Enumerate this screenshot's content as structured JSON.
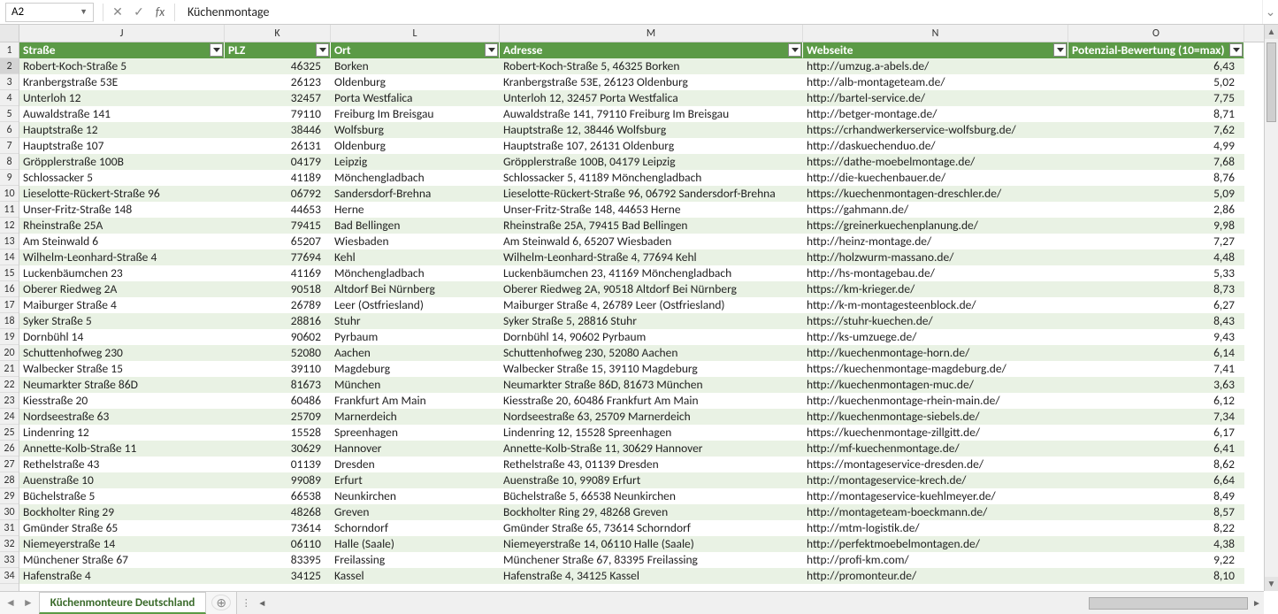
{
  "namebox": "A2",
  "formula": "Küchenmontage",
  "sheet_tab": "Küchenmonteure Deutschland",
  "columns": [
    {
      "letter": "J",
      "header": "Straße",
      "w": "col-j"
    },
    {
      "letter": "K",
      "header": "PLZ",
      "w": "col-k"
    },
    {
      "letter": "L",
      "header": "Ort",
      "w": "col-l"
    },
    {
      "letter": "M",
      "header": "Adresse",
      "w": "col-m"
    },
    {
      "letter": "N",
      "header": "Webseite",
      "w": "col-n"
    },
    {
      "letter": "O",
      "header": "Potenzial-Bewertung (10=max)",
      "w": "col-o"
    }
  ],
  "rows": [
    {
      "n": 2,
      "s": "Robert-Koch-Straße 5",
      "p": "46325",
      "o": "Borken",
      "a": "Robert-Koch-Straße 5, 46325 Borken",
      "w": "http://umzug.a-abels.de/",
      "b": "6,43"
    },
    {
      "n": 3,
      "s": "Kranbergstraße 53E",
      "p": "26123",
      "o": "Oldenburg",
      "a": "Kranbergstraße 53E, 26123 Oldenburg",
      "w": "http://alb-montageteam.de/",
      "b": "5,02"
    },
    {
      "n": 4,
      "s": "Unterloh 12",
      "p": "32457",
      "o": "Porta Westfalica",
      "a": "Unterloh 12, 32457 Porta Westfalica",
      "w": "http://bartel-service.de/",
      "b": "7,75"
    },
    {
      "n": 5,
      "s": "Auwaldstraße 141",
      "p": "79110",
      "o": "Freiburg Im Breisgau",
      "a": "Auwaldstraße 141, 79110 Freiburg Im Breisgau",
      "w": "http://betger-montage.de/",
      "b": "8,71"
    },
    {
      "n": 6,
      "s": "Hauptstraße 12",
      "p": "38446",
      "o": "Wolfsburg",
      "a": "Hauptstraße 12, 38446 Wolfsburg",
      "w": "https://crhandwerkerservice-wolfsburg.de/",
      "b": "7,62"
    },
    {
      "n": 7,
      "s": "Hauptstraße 107",
      "p": "26131",
      "o": "Oldenburg",
      "a": "Hauptstraße 107, 26131 Oldenburg",
      "w": "http://daskuechenduo.de/",
      "b": "4,99"
    },
    {
      "n": 8,
      "s": "Gröpplerstraße 100B",
      "p": "04179",
      "o": "Leipzig",
      "a": "Gröpplerstraße 100B, 04179 Leipzig",
      "w": "https://dathe-moebelmontage.de/",
      "b": "7,68"
    },
    {
      "n": 9,
      "s": "Schlossacker 5",
      "p": "41189",
      "o": "Mönchengladbach",
      "a": "Schlossacker 5, 41189 Mönchengladbach",
      "w": "http://die-kuechenbauer.de/",
      "b": "8,76"
    },
    {
      "n": 10,
      "s": "Lieselotte-Rückert-Straße 96",
      "p": "06792",
      "o": "Sandersdorf-Brehna",
      "a": "Lieselotte-Rückert-Straße 96, 06792 Sandersdorf-Brehna",
      "w": "https://kuechenmontagen-dreschler.de/",
      "b": "5,09"
    },
    {
      "n": 11,
      "s": "Unser-Fritz-Straße 148",
      "p": "44653",
      "o": "Herne",
      "a": "Unser-Fritz-Straße 148, 44653 Herne",
      "w": "https://gahmann.de/",
      "b": "2,86"
    },
    {
      "n": 12,
      "s": "Rheinstraße 25A",
      "p": "79415",
      "o": "Bad Bellingen",
      "a": "Rheinstraße 25A, 79415 Bad Bellingen",
      "w": "https://greinerkuechenplanung.de/",
      "b": "9,98"
    },
    {
      "n": 13,
      "s": "Am Steinwald 6",
      "p": "65207",
      "o": "Wiesbaden",
      "a": "Am Steinwald 6, 65207 Wiesbaden",
      "w": "http://heinz-montage.de/",
      "b": "7,27"
    },
    {
      "n": 14,
      "s": "Wilhelm-Leonhard-Straße 4",
      "p": "77694",
      "o": "Kehl",
      "a": "Wilhelm-Leonhard-Straße 4, 77694 Kehl",
      "w": "http://holzwurm-massano.de/",
      "b": "4,48"
    },
    {
      "n": 15,
      "s": "Luckenbäumchen 23",
      "p": "41169",
      "o": "Mönchengladbach",
      "a": "Luckenbäumchen 23, 41169 Mönchengladbach",
      "w": "http://hs-montagebau.de/",
      "b": "5,33"
    },
    {
      "n": 16,
      "s": "Oberer Riedweg 2A",
      "p": "90518",
      "o": "Altdorf Bei Nürnberg",
      "a": "Oberer Riedweg 2A, 90518 Altdorf Bei Nürnberg",
      "w": "https://km-krieger.de/",
      "b": "8,73"
    },
    {
      "n": 17,
      "s": "Maiburger Straße 4",
      "p": "26789",
      "o": "Leer (Ostfriesland)",
      "a": "Maiburger Straße 4, 26789 Leer (Ostfriesland)",
      "w": "http://k-m-montagesteenblock.de/",
      "b": "6,27"
    },
    {
      "n": 18,
      "s": "Syker Straße 5",
      "p": "28816",
      "o": "Stuhr",
      "a": "Syker Straße 5, 28816 Stuhr",
      "w": "https://stuhr-kuechen.de/",
      "b": "8,43"
    },
    {
      "n": 19,
      "s": "Dornbühl 14",
      "p": "90602",
      "o": "Pyrbaum",
      "a": "Dornbühl 14, 90602 Pyrbaum",
      "w": "http://ks-umzuege.de/",
      "b": "9,43"
    },
    {
      "n": 20,
      "s": "Schuttenhofweg 230",
      "p": "52080",
      "o": "Aachen",
      "a": "Schuttenhofweg 230, 52080 Aachen",
      "w": "http://kuechenmontage-horn.de/",
      "b": "6,14"
    },
    {
      "n": 21,
      "s": "Walbecker Straße 15",
      "p": "39110",
      "o": "Magdeburg",
      "a": "Walbecker Straße 15, 39110 Magdeburg",
      "w": "https://kuechenmontage-magdeburg.de/",
      "b": "7,41"
    },
    {
      "n": 22,
      "s": "Neumarkter Straße 86D",
      "p": "81673",
      "o": "München",
      "a": "Neumarkter Straße 86D, 81673 München",
      "w": "http://kuechenmontagen-muc.de/",
      "b": "3,63"
    },
    {
      "n": 23,
      "s": "Kiesstraße 20",
      "p": "60486",
      "o": "Frankfurt Am Main",
      "a": "Kiesstraße 20, 60486 Frankfurt Am Main",
      "w": "http://kuechenmontage-rhein-main.de/",
      "b": "6,12"
    },
    {
      "n": 24,
      "s": "Nordseestraße 63",
      "p": "25709",
      "o": "Marnerdeich",
      "a": "Nordseestraße 63, 25709 Marnerdeich",
      "w": "http://kuechenmontage-siebels.de/",
      "b": "7,34"
    },
    {
      "n": 25,
      "s": "Lindenring 12",
      "p": "15528",
      "o": "Spreenhagen",
      "a": "Lindenring 12, 15528 Spreenhagen",
      "w": "https://kuechenmontage-zillgitt.de/",
      "b": "6,17"
    },
    {
      "n": 26,
      "s": "Annette-Kolb-Straße 11",
      "p": "30629",
      "o": "Hannover",
      "a": "Annette-Kolb-Straße 11, 30629 Hannover",
      "w": "http://mf-kuechenmontage.de/",
      "b": "6,41"
    },
    {
      "n": 27,
      "s": "Rethelstraße 43",
      "p": "01139",
      "o": "Dresden",
      "a": "Rethelstraße 43, 01139 Dresden",
      "w": "https://montageservice-dresden.de/",
      "b": "8,62"
    },
    {
      "n": 28,
      "s": "Auenstraße 10",
      "p": "99089",
      "o": "Erfurt",
      "a": "Auenstraße 10, 99089 Erfurt",
      "w": "http://montageservice-krech.de/",
      "b": "6,64"
    },
    {
      "n": 29,
      "s": "Büchelstraße 5",
      "p": "66538",
      "o": "Neunkirchen",
      "a": "Büchelstraße 5, 66538 Neunkirchen",
      "w": "http://montageservice-kuehlmeyer.de/",
      "b": "8,49"
    },
    {
      "n": 30,
      "s": "Bockholter Ring 29",
      "p": "48268",
      "o": "Greven",
      "a": "Bockholter Ring 29, 48268 Greven",
      "w": "http://montageteam-boeckmann.de/",
      "b": "8,57"
    },
    {
      "n": 31,
      "s": "Gmünder Straße 65",
      "p": "73614",
      "o": "Schorndorf",
      "a": "Gmünder Straße 65, 73614 Schorndorf",
      "w": "http://mtm-logistik.de/",
      "b": "8,22"
    },
    {
      "n": 32,
      "s": "Niemeyerstraße 14",
      "p": "06110",
      "o": "Halle (Saale)",
      "a": "Niemeyerstraße 14, 06110 Halle (Saale)",
      "w": "http://perfektmoebelmontagen.de/",
      "b": "4,38"
    },
    {
      "n": 33,
      "s": "Münchener Straße 67",
      "p": "83395",
      "o": "Freilassing",
      "a": "Münchener Straße 67, 83395 Freilassing",
      "w": "http://profi-km.com/",
      "b": "9,22"
    },
    {
      "n": 34,
      "s": "Hafenstraße 4",
      "p": "34125",
      "o": "Kassel",
      "a": "Hafenstraße 4, 34125 Kassel",
      "w": "http://promonteur.de/",
      "b": "8,10"
    }
  ]
}
